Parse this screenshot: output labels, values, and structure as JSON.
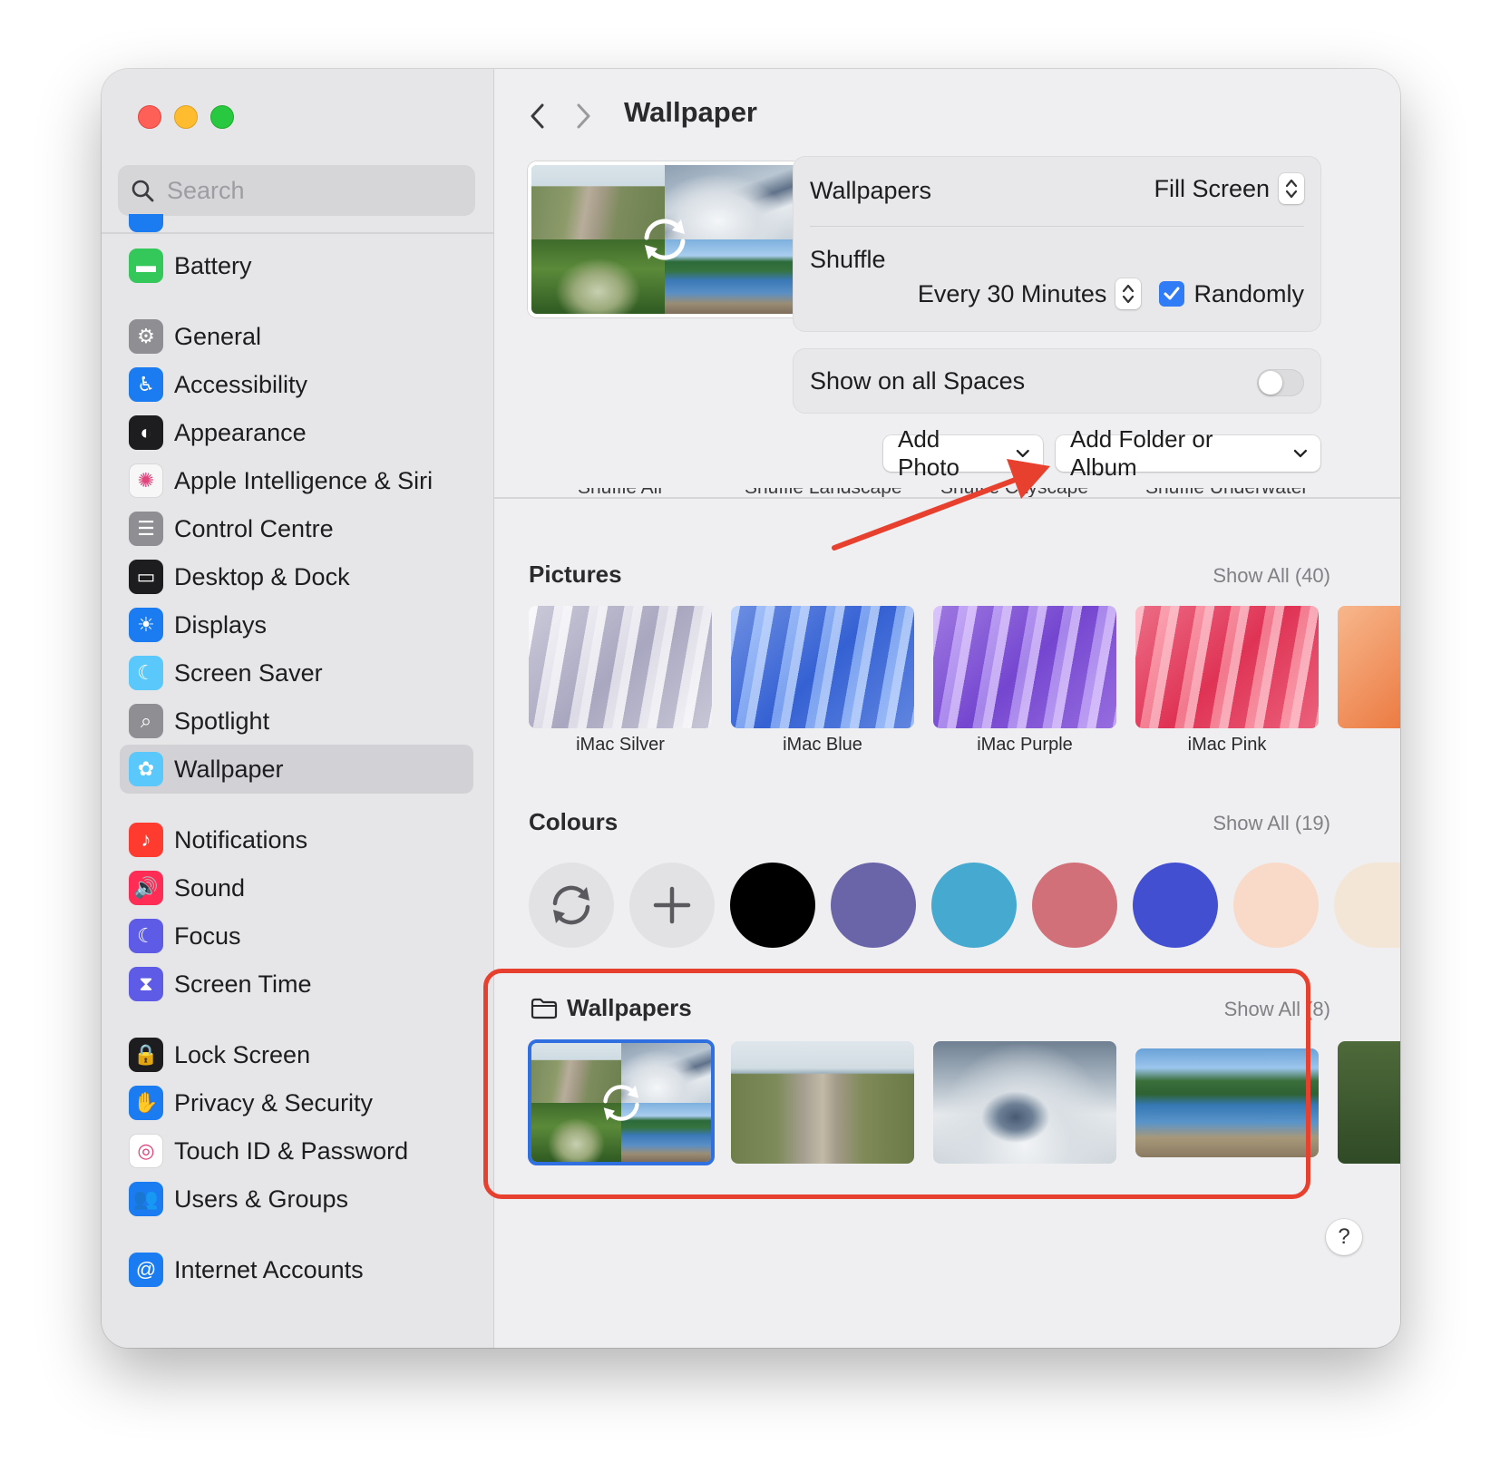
{
  "window": {
    "title": "Wallpaper"
  },
  "sidebar": {
    "search_placeholder": "Search",
    "items": [
      {
        "label": "Battery",
        "icon": "battery-icon",
        "color": "#34c759"
      },
      {
        "label": "General",
        "icon": "gear-icon",
        "color": "#8e8e93"
      },
      {
        "label": "Accessibility",
        "icon": "accessibility-icon",
        "color": "#1a7cf0"
      },
      {
        "label": "Appearance",
        "icon": "appearance-icon",
        "color": "#1d1d1f"
      },
      {
        "label": "Apple Intelligence & Siri",
        "icon": "siri-icon",
        "color": "#f7f7f7"
      },
      {
        "label": "Control Centre",
        "icon": "control-centre-icon",
        "color": "#8e8e93"
      },
      {
        "label": "Desktop & Dock",
        "icon": "dock-icon",
        "color": "#1d1d1f"
      },
      {
        "label": "Displays",
        "icon": "sun-icon",
        "color": "#1a7cf0"
      },
      {
        "label": "Screen Saver",
        "icon": "screen-saver-icon",
        "color": "#5ac8fa"
      },
      {
        "label": "Spotlight",
        "icon": "magnifier-icon",
        "color": "#8e8e93"
      },
      {
        "label": "Wallpaper",
        "icon": "flower-icon",
        "color": "#5ac8fa",
        "selected": true
      },
      {
        "label": "Notifications",
        "icon": "bell-icon",
        "color": "#ff3b30"
      },
      {
        "label": "Sound",
        "icon": "speaker-icon",
        "color": "#ff2d55"
      },
      {
        "label": "Focus",
        "icon": "moon-icon",
        "color": "#5e5ce6"
      },
      {
        "label": "Screen Time",
        "icon": "hourglass-icon",
        "color": "#5e5ce6"
      },
      {
        "label": "Lock Screen",
        "icon": "lock-icon",
        "color": "#1d1d1f"
      },
      {
        "label": "Privacy & Security",
        "icon": "hand-icon",
        "color": "#1a7cf0"
      },
      {
        "label": "Touch ID & Password",
        "icon": "fingerprint-icon",
        "color": "#ffffff"
      },
      {
        "label": "Users & Groups",
        "icon": "users-icon",
        "color": "#1a7cf0"
      },
      {
        "label": "Internet Accounts",
        "icon": "at-icon",
        "color": "#1a7cf0"
      }
    ]
  },
  "settings": {
    "source_label": "Wallpapers",
    "fit_value": "Fill Screen",
    "shuffle_label": "Shuffle",
    "shuffle_interval": "Every 30 Minutes",
    "randomly_label": "Randomly",
    "randomly_checked": true,
    "spaces_label": "Show on all Spaces",
    "spaces_on": false
  },
  "buttons": {
    "add_photo": "Add Photo",
    "add_folder": "Add Folder or Album"
  },
  "dynamic_row": {
    "labels": [
      "Shuffle All",
      "Shuffle Landscape",
      "Shuffle Cityscape",
      "Shuffle Underwater"
    ]
  },
  "pictures": {
    "title": "Pictures",
    "show_all": "Show All (40)",
    "items": [
      {
        "caption": "iMac Silver"
      },
      {
        "caption": "iMac Blue"
      },
      {
        "caption": "iMac Purple"
      },
      {
        "caption": "iMac Pink"
      }
    ]
  },
  "colours": {
    "title": "Colours",
    "show_all": "Show All (19)",
    "swatches": [
      "#000000",
      "#6a64a9",
      "#46a9cf",
      "#d2707a",
      "#434fd1",
      "#f9d9c8",
      "#f4e6d6"
    ]
  },
  "wallpapers_folder": {
    "title": "Wallpapers",
    "show_all": "Show All (8)"
  },
  "help": {
    "label": "?"
  },
  "annotation": {
    "highlight_color": "#e8402e",
    "arrow_color": "#e8402e"
  }
}
